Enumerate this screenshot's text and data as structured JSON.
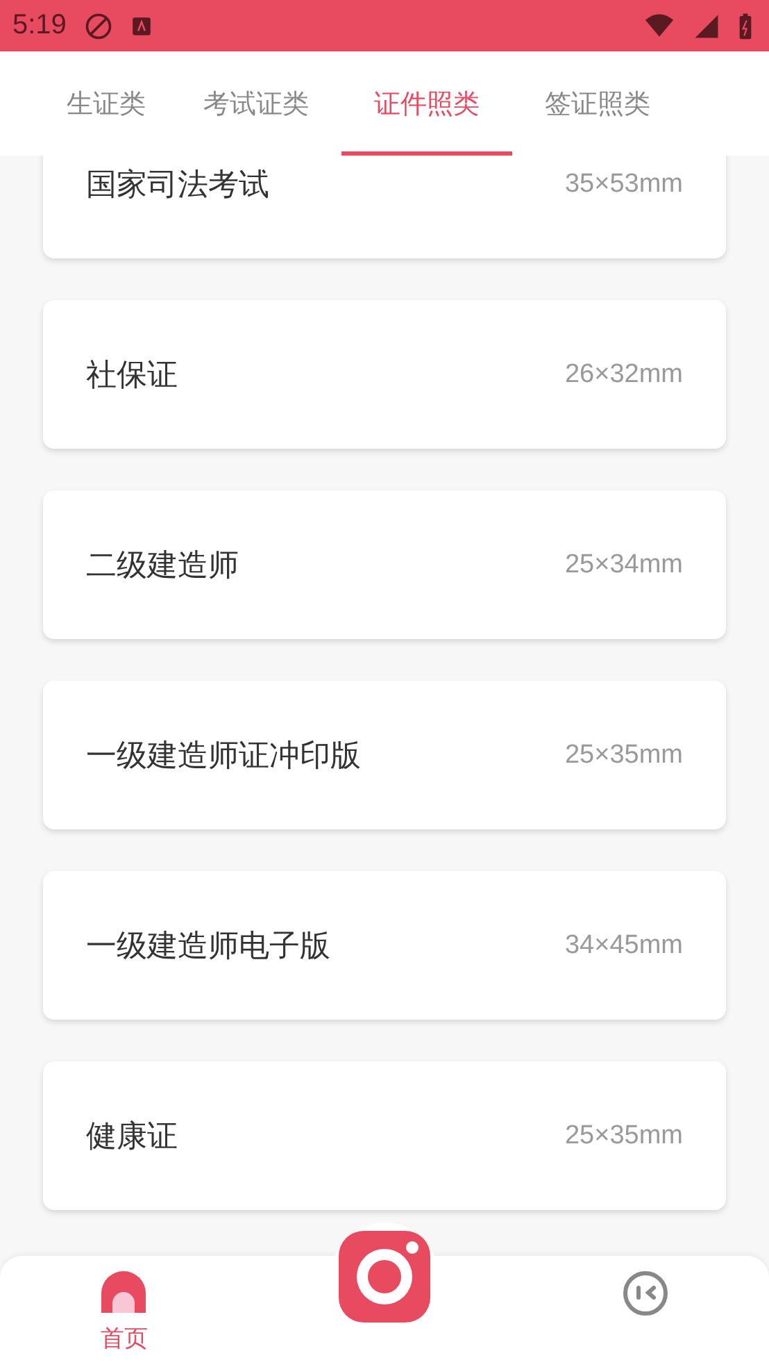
{
  "status_bar": {
    "time": "5:19"
  },
  "tabs": [
    {
      "label": "生证类",
      "selected": false
    },
    {
      "label": "考试证类",
      "selected": false
    },
    {
      "label": "证件照类",
      "selected": true
    },
    {
      "label": "签证照类",
      "selected": false
    }
  ],
  "cards": [
    {
      "name": "国家司法考试",
      "size": "35×53mm"
    },
    {
      "name": "社保证",
      "size": "26×32mm"
    },
    {
      "name": "二级建造师",
      "size": "25×34mm"
    },
    {
      "name": "一级建造师证冲印版",
      "size": "25×35mm"
    },
    {
      "name": "一级建造师电子版",
      "size": "34×45mm"
    },
    {
      "name": "健康证",
      "size": "25×35mm"
    }
  ],
  "bottom_nav": [
    {
      "kind": "home",
      "label": "首页",
      "selected": true
    },
    {
      "kind": "camera"
    },
    {
      "kind": "profile",
      "selected": false
    }
  ]
}
